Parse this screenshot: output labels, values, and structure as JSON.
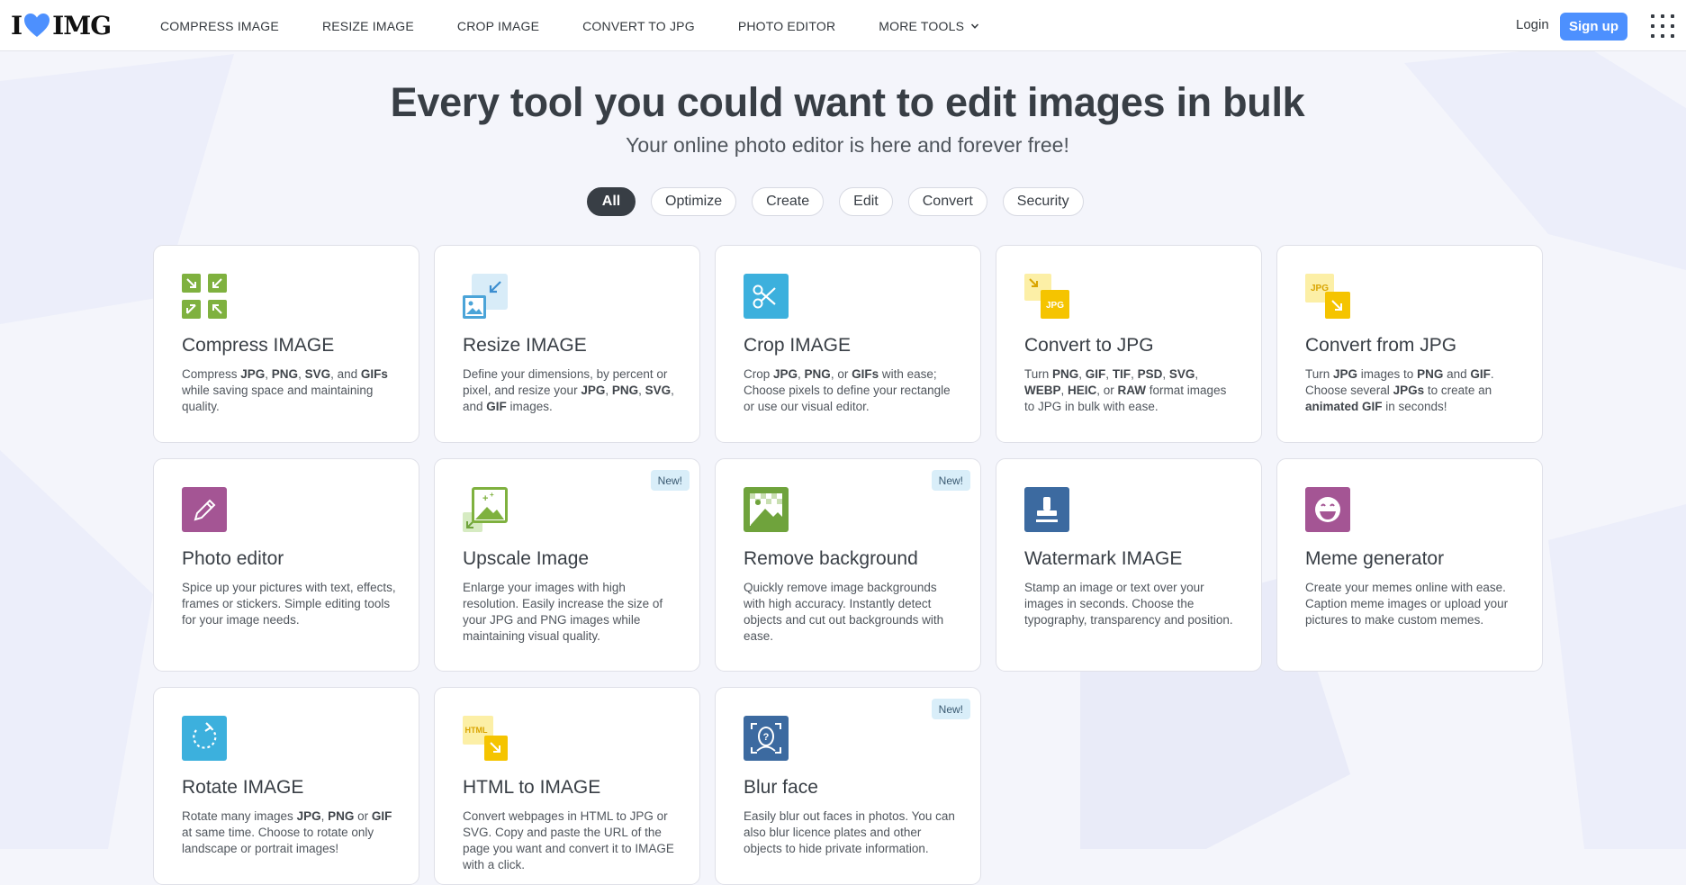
{
  "header": {
    "logo": {
      "left": "I",
      "right": "IMG"
    },
    "nav": [
      {
        "label": "COMPRESS IMAGE"
      },
      {
        "label": "RESIZE IMAGE"
      },
      {
        "label": "CROP IMAGE"
      },
      {
        "label": "CONVERT TO JPG"
      },
      {
        "label": "PHOTO EDITOR"
      },
      {
        "label": "MORE TOOLS"
      }
    ],
    "login": "Login",
    "signup": "Sign up"
  },
  "hero": {
    "title": "Every tool you could want to edit images in bulk",
    "subtitle": "Your online photo editor is here and forever free!"
  },
  "filters": [
    "All",
    "Optimize",
    "Create",
    "Edit",
    "Convert",
    "Security"
  ],
  "active_filter": "All",
  "badge_new": "New!",
  "tools": [
    {
      "title": "Compress IMAGE",
      "desc": [
        "Compress ",
        "JPG",
        ", ",
        "PNG",
        ", ",
        "SVG",
        ", and ",
        "GIFs",
        " while saving space and maintaining quality."
      ],
      "icon": "compress-icon",
      "color": "#6fa33c"
    },
    {
      "title": "Resize IMAGE",
      "desc": [
        "Define your dimensions, by percent or pixel, and resize your ",
        "JPG",
        ", ",
        "PNG",
        ", ",
        "SVG",
        ", and ",
        "GIF",
        " images."
      ],
      "icon": "resize-icon",
      "color": "#4ba4d8"
    },
    {
      "title": "Crop IMAGE",
      "desc": [
        "Crop ",
        "JPG",
        ", ",
        "PNG",
        ", or ",
        "GIFs",
        " with ease; Choose pixels to define your rectangle or use our visual editor."
      ],
      "icon": "crop-icon",
      "color": "#3cb0dd"
    },
    {
      "title": "Convert to JPG",
      "desc": [
        "Turn ",
        "PNG",
        ", ",
        "GIF",
        ", ",
        "TIF",
        ", ",
        "PSD",
        ", ",
        "SVG",
        ", ",
        "WEBP",
        ", ",
        "HEIC",
        ", or ",
        "RAW",
        " format images to JPG in bulk with ease."
      ],
      "icon": "convert-to-jpg-icon",
      "color": "#f5c400"
    },
    {
      "title": "Convert from JPG",
      "desc": [
        "Turn ",
        "JPG",
        " images to ",
        "PNG",
        " and ",
        "GIF",
        ". Choose several ",
        "JPGs",
        " to create an ",
        "animated GIF",
        " in seconds!"
      ],
      "icon": "convert-from-jpg-icon",
      "color": "#f5c400"
    },
    {
      "title": "Photo editor",
      "desc": [
        "Spice up your pictures with text, effects, frames or stickers. Simple editing tools for your image needs."
      ],
      "icon": "photo-editor-icon",
      "color": "#a45594"
    },
    {
      "title": "Upscale Image",
      "desc": [
        "Enlarge your images with high resolution. Easily increase the size of your JPG and PNG images while maintaining visual quality."
      ],
      "icon": "upscale-icon",
      "color": "#6fa33c",
      "new": true
    },
    {
      "title": "Remove background",
      "desc": [
        "Quickly remove image backgrounds with high accuracy. Instantly detect objects and cut out backgrounds with ease."
      ],
      "icon": "remove-background-icon",
      "color": "#6fa33c",
      "new": true
    },
    {
      "title": "Watermark IMAGE",
      "desc": [
        "Stamp an image or text over your images in seconds. Choose the typography, transparency and position."
      ],
      "icon": "watermark-icon",
      "color": "#3c6aa0"
    },
    {
      "title": "Meme generator",
      "desc": [
        "Create your memes online with ease. Caption meme images or upload your pictures to make custom memes."
      ],
      "icon": "meme-icon",
      "color": "#a45594"
    },
    {
      "title": "Rotate IMAGE",
      "desc": [
        "Rotate many images ",
        "JPG",
        ", ",
        "PNG",
        " or ",
        "GIF",
        " at same time. Choose to rotate only landscape or portrait images!"
      ],
      "icon": "rotate-icon",
      "color": "#3cb0dd"
    },
    {
      "title": "HTML to IMAGE",
      "desc": [
        "Convert webpages in HTML to JPG or SVG. Copy and paste the URL of the page you want and convert it to IMAGE with a click."
      ],
      "icon": "html-to-image-icon",
      "color": "#f5c400"
    },
    {
      "title": "Blur face",
      "desc": [
        "Easily blur out faces in photos. You can also blur licence plates and other objects to hide private information."
      ],
      "icon": "blur-face-icon",
      "color": "#3c6aa0",
      "new": true
    }
  ]
}
